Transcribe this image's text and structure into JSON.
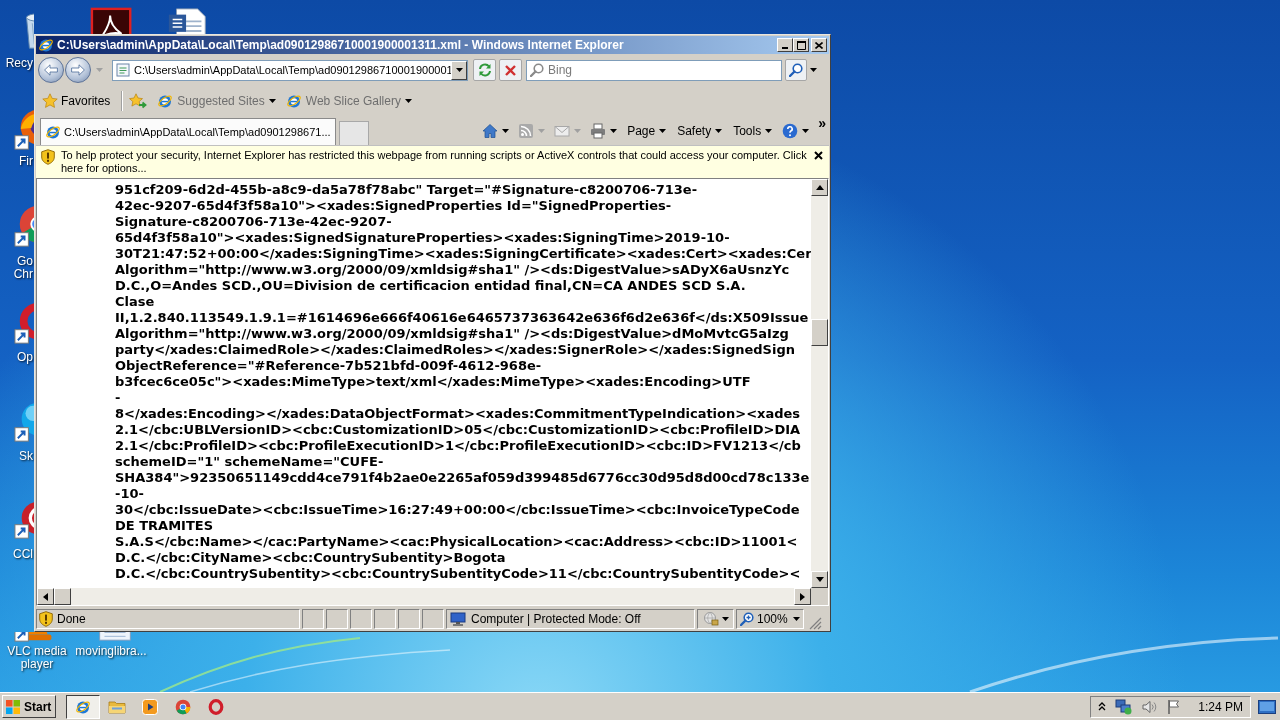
{
  "desktop": {
    "top_icons": [
      {
        "kind": "pdf"
      },
      {
        "kind": "word"
      }
    ],
    "icons": [
      {
        "kind": "bin",
        "label": "Recy",
        "shortcut": false
      },
      {
        "kind": "fox",
        "label": "Fir",
        "shortcut": true
      },
      {
        "kind": "wheel",
        "label": "Go Chr",
        "shortcut": true
      },
      {
        "kind": "ring",
        "label": "Op",
        "shortcut": true
      },
      {
        "kind": "cloud",
        "label": "Sk",
        "shortcut": true
      },
      {
        "kind": "broom",
        "label": "CCl",
        "shortcut": true
      },
      {
        "kind": "cone",
        "label": "VLC media player",
        "shortcut": true
      },
      {
        "kind": "file",
        "label": "movinglibra...",
        "shortcut": false
      }
    ]
  },
  "window": {
    "title": "C:\\Users\\admin\\AppData\\Local\\Temp\\ad09012986710001900001311.xml - Windows Internet Explorer",
    "address": "C:\\Users\\admin\\AppData\\Local\\Temp\\ad09012986710001900001",
    "search": {
      "placeholder": "Bing"
    },
    "favorites": {
      "label": "Favorites",
      "links": [
        {
          "label": "Suggested Sites"
        },
        {
          "label": "Web Slice Gallery"
        }
      ]
    },
    "tabs": [
      {
        "label": "C:\\Users\\admin\\AppData\\Local\\Temp\\ad0901298671...",
        "selected": true
      }
    ],
    "commands": [
      {
        "kind": "home",
        "disabled": false
      },
      {
        "kind": "feeds",
        "disabled": true
      },
      {
        "kind": "mail",
        "disabled": true
      },
      {
        "kind": "print",
        "disabled": false
      },
      {
        "kind": "menu",
        "label": "Page"
      },
      {
        "kind": "menu",
        "label": "Safety"
      },
      {
        "kind": "menu",
        "label": "Tools"
      },
      {
        "kind": "help",
        "disabled": false
      }
    ],
    "overflow": "»",
    "info_bar": {
      "text": "To help protect your security, Internet Explorer has restricted this webpage from running scripts or ActiveX controls that could access your computer. Click here for options..."
    },
    "content_lines": [
      "951cf209-6d2d-455b-a8c9-da5a78f78abc\" Target=\"#Signature-c8200706-713e-",
      "42ec-9207-65d4f3f58a10\"><xades:SignedProperties Id=\"SignedProperties-",
      "Signature-c8200706-713e-42ec-9207-",
      "65d4f3f58a10\"><xades:SignedSignatureProperties><xades:SigningTime>2019-10-",
      "30T21:47:52+00:00</xades:SigningTime><xades:SigningCertificate><xades:Cert><xades:Cer",
      "Algorithm=\"http://www.w3.org/2000/09/xmldsig#sha1\" /><ds:DigestValue>sADyX6aUsnzYc",
      "D.C.,O=Andes SCD.,OU=Division de certificacion entidad final,CN=CA ANDES SCD S.A.",
      "Clase",
      "II,1.2.840.113549.1.9.1=#1614696e666f40616e6465737363642e636f6d2e636f</ds:X509Issue",
      "Algorithm=\"http://www.w3.org/2000/09/xmldsig#sha1\" /><ds:DigestValue>dMoMvtcG5aIzg",
      "party</xades:ClaimedRole></xades:ClaimedRoles></xades:SignerRole></xades:SignedSign",
      "ObjectReference=\"#Reference-7b521bfd-009f-4612-968e-",
      "b3fcec6ce05c\"><xades:MimeType>text/xml</xades:MimeType><xades:Encoding>UTF",
      "-",
      "8</xades:Encoding></xades:DataObjectFormat><xades:CommitmentTypeIndication><xades",
      "2.1</cbc:UBLVersionID><cbc:CustomizationID>05</cbc:CustomizationID><cbc:ProfileID>DIA",
      "2.1</cbc:ProfileID><cbc:ProfileExecutionID>1</cbc:ProfileExecutionID><cbc:ID>FV1213</cb",
      "schemeID=\"1\" schemeName=\"CUFE-",
      "SHA384\">92350651149cdd4ce791f4b2ae0e2265af059d399485d6776cc30d95d8d00cd78c133e",
      "-10-",
      "30</cbc:IssueDate><cbc:IssueTime>16:27:49+00:00</cbc:IssueTime><cbc:InvoiceTypeCode",
      "DE TRAMITES",
      "S.A.S</cbc:Name></cac:PartyName><cac:PhysicalLocation><cac:Address><cbc:ID>11001<",
      "D.C.</cbc:CityName><cbc:CountrySubentity>Bogota",
      "D.C.</cbc:CountrySubentity><cbc:CountrySubentityCode>11</cbc:CountrySubentityCode><"
    ],
    "status_bar": {
      "text": "Done",
      "zone": "Computer | Protected Mode: Off",
      "zoom": "100%"
    }
  },
  "taskbar": {
    "start": "Start",
    "buttons": [
      {
        "kind": "ie",
        "selected": true
      },
      {
        "kind": "folder",
        "selected": false
      },
      {
        "kind": "media",
        "selected": false
      },
      {
        "kind": "chrome",
        "selected": false
      },
      {
        "kind": "opera",
        "selected": false
      }
    ],
    "clock": "1:24 PM"
  }
}
